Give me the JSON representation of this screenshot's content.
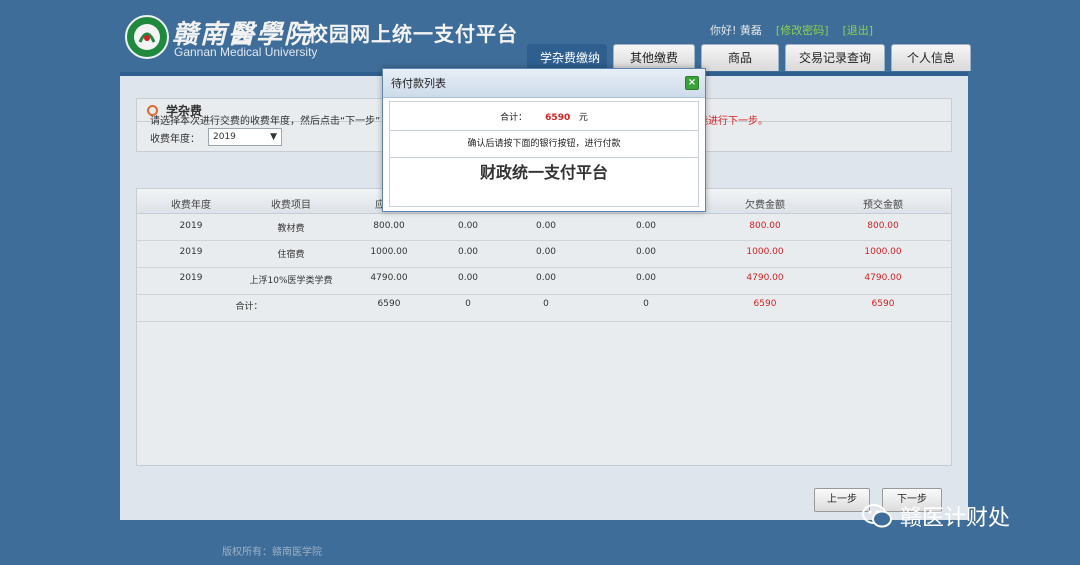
{
  "header": {
    "logo_cn": "赣南醫學院",
    "logo_en": "Gannan Medical University",
    "site_title": "校园网上统一支付平台",
    "user_greeting": "你好! 黄磊",
    "change_password": "[修改密码]",
    "logout": "[退出]"
  },
  "nav": {
    "tabs": [
      {
        "label": "学杂费缴纳",
        "active": true
      },
      {
        "label": "其他缴费",
        "active": false
      },
      {
        "label": "商品",
        "active": false
      },
      {
        "label": "交易记录查询",
        "active": false
      },
      {
        "label": "个人信息",
        "active": false
      }
    ]
  },
  "section": {
    "title": "学杂费",
    "instruction": "请选择本次进行交费的收费年度，然后点击“下一步”",
    "instruction_red": "不能进行下一步。",
    "year_label": "收费年度：",
    "year_value": "2019"
  },
  "table": {
    "headers": [
      "收费年度",
      "收费项目",
      "应收",
      "",
      "",
      "",
      "欠费金额",
      "预交金额"
    ],
    "rows": [
      [
        "2019",
        "教材费",
        "800.00",
        "0.00",
        "0.00",
        "0.00",
        "800.00",
        "800.00"
      ],
      [
        "2019",
        "住宿费",
        "1000.00",
        "0.00",
        "0.00",
        "0.00",
        "1000.00",
        "1000.00"
      ],
      [
        "2019",
        "上浮10%医学类学费",
        "4790.00",
        "0.00",
        "0.00",
        "0.00",
        "4790.00",
        "4790.00"
      ]
    ],
    "total": [
      "",
      "合计：",
      "6590",
      "0",
      "0",
      "0",
      "6590",
      "6590"
    ]
  },
  "buttons": {
    "prev": "上一步",
    "next": "下一步"
  },
  "dialog": {
    "title": "待付款列表",
    "total_label": "合计：",
    "total_amount": "6590",
    "total_unit": "元",
    "confirm_text": "确认后请按下面的银行按钮，进行付款",
    "platform_button": "财政统一支付平台"
  },
  "footer": {
    "copyright": "版权所有：赣南医学院"
  },
  "watermark": {
    "text": "赣医计财处"
  },
  "colors": {
    "background": "#3f6d99",
    "accent": "#2f5f8f",
    "alert_red": "#d62020"
  }
}
